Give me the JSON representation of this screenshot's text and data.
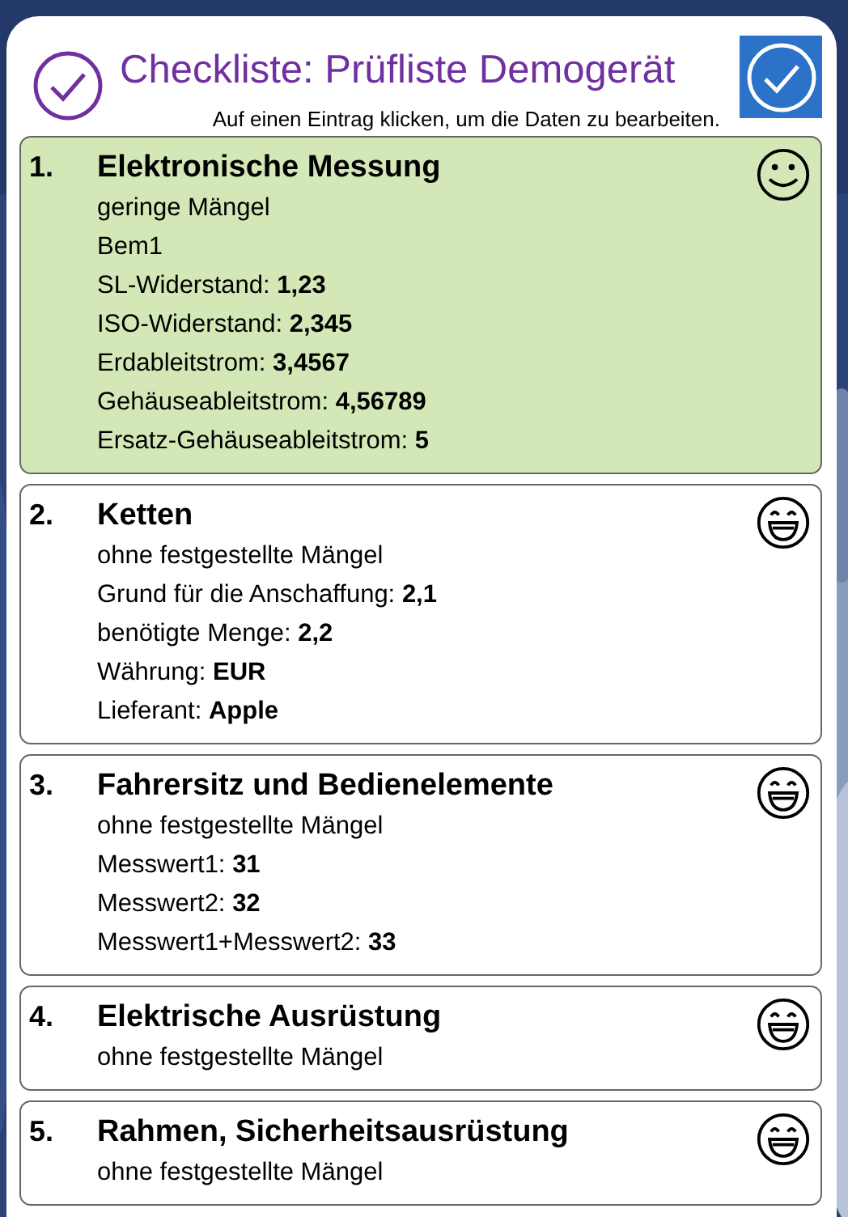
{
  "header": {
    "title": "Checkliste: Prüfliste Demogerät",
    "subtitle": "Auf einen Eintrag klicken, um die Daten zu bearbeiten."
  },
  "items": [
    {
      "number": "1.",
      "title": "Elektronische Messung",
      "kind": "minor",
      "status": "geringe Mängel",
      "lines": [
        {
          "label": "Bem1"
        },
        {
          "label": "SL-Widerstand:",
          "value": "1,23"
        },
        {
          "label": "ISO-Widerstand:",
          "value": "2,345"
        },
        {
          "label": "Erdableitstrom:",
          "value": "3,4567"
        },
        {
          "label": "Gehäuseableitstrom:",
          "value": "4,56789"
        },
        {
          "label": "Ersatz-Gehäuseableitstrom:",
          "value": "5"
        }
      ]
    },
    {
      "number": "2.",
      "title": "Ketten",
      "kind": "ok",
      "status": "ohne festgestellte Mängel",
      "lines": [
        {
          "label": "Grund für die Anschaffung:",
          "value": "2,1"
        },
        {
          "label": "benötigte Menge:",
          "value": "2,2"
        },
        {
          "label": "Währung:",
          "value": "EUR"
        },
        {
          "label": "Lieferant:",
          "value": "Apple"
        }
      ]
    },
    {
      "number": "3.",
      "title": "Fahrersitz und Bedienelemente",
      "kind": "ok",
      "status": "ohne festgestellte Mängel",
      "lines": [
        {
          "label": "Messwert1:",
          "value": "31"
        },
        {
          "label": "Messwert2:",
          "value": "32"
        },
        {
          "label": "Messwert1+Messwert2:",
          "value": "33"
        }
      ]
    },
    {
      "number": "4.",
      "title": "Elektrische Ausrüstung",
      "kind": "ok",
      "status": "ohne festgestellte Mängel"
    },
    {
      "number": "5.",
      "title": "Rahmen, Sicherheitsausrüstung",
      "kind": "ok",
      "status": "ohne festgestellte Mängel"
    }
  ]
}
